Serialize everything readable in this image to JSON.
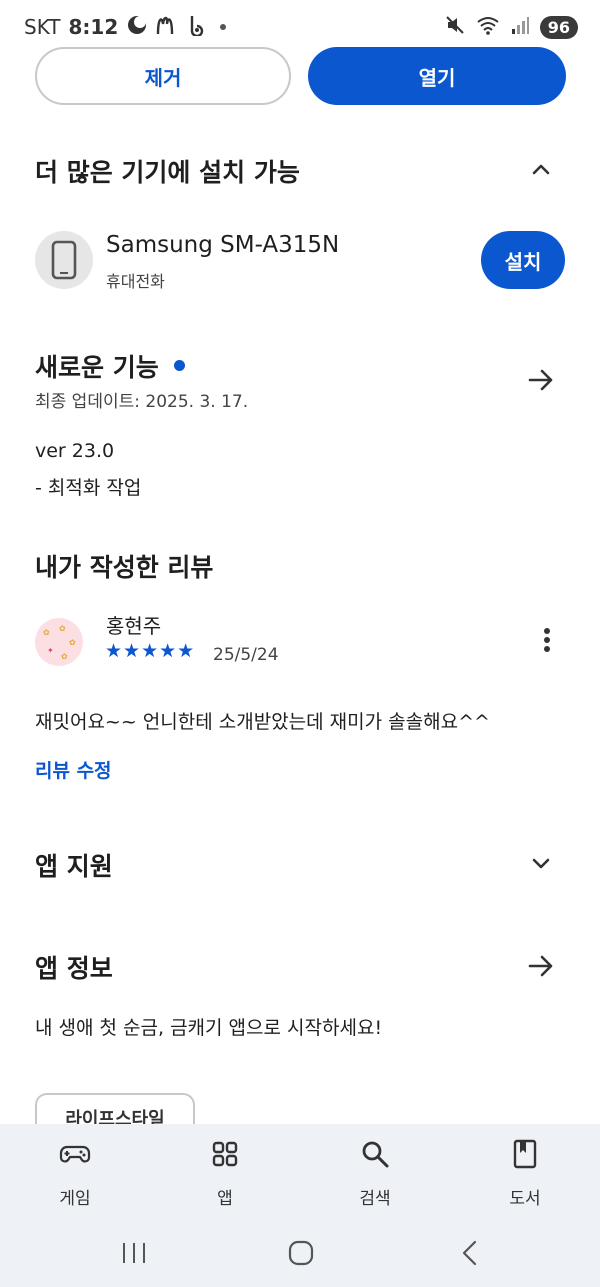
{
  "status_bar": {
    "carrier": "SKT",
    "time": "8:12",
    "battery": "96",
    "left_icons": [
      "moon-icon",
      "mcdonalds-icon",
      "b-app-icon",
      "dot"
    ],
    "right_icons": [
      "mute-icon",
      "wifi-icon",
      "signal-icon"
    ]
  },
  "actions": {
    "remove_label": "제거",
    "open_label": "열기"
  },
  "devices_section": {
    "title": "더 많은 기기에 설치 가능",
    "device": {
      "name": "Samsung SM-A315N",
      "type": "휴대전화",
      "install_label": "설치"
    }
  },
  "whats_new": {
    "title": "새로운 기능",
    "last_updated": "최종 업데이트: 2025. 3. 17.",
    "version": "ver 23.0",
    "notes": "- 최적화 작업"
  },
  "my_review": {
    "title": "내가 작성한 리뷰",
    "reviewer": "홍현주",
    "stars": "★★★★★",
    "rating": 5,
    "date": "25/5/24",
    "text": "재밋어요~~ 언니한테 소개받았는데 재미가 솔솔해요^^",
    "edit_label": "리뷰 수정"
  },
  "app_support": {
    "title": "앱 지원"
  },
  "app_info": {
    "title": "앱 정보",
    "description": "내 생애 첫 순금, 금캐기 앱으로 시작하세요!",
    "category_chip": "라이프스타일"
  },
  "bottom_nav": {
    "items": [
      {
        "label": "게임",
        "icon": "gamepad-icon"
      },
      {
        "label": "앱",
        "icon": "apps-grid-icon"
      },
      {
        "label": "검색",
        "icon": "search-icon"
      },
      {
        "label": "도서",
        "icon": "book-icon"
      }
    ]
  },
  "colors": {
    "accent": "#0b57d0",
    "nav_background": "#eef1f6",
    "text": "#1f1f1f"
  }
}
